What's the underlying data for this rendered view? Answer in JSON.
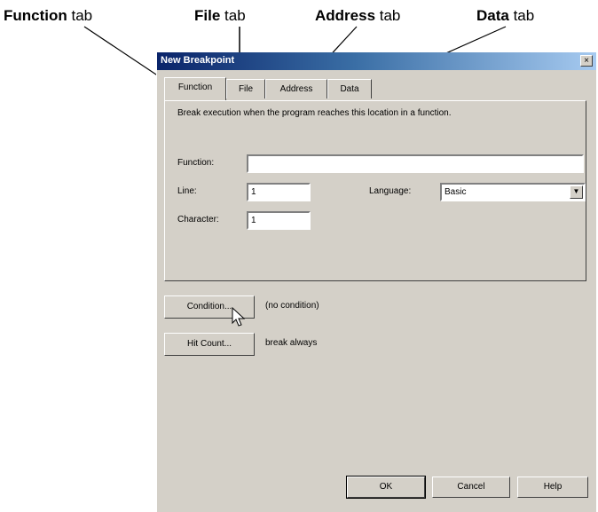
{
  "callouts": {
    "function": {
      "bold": "Function",
      "rest": " tab"
    },
    "file": {
      "bold": "File",
      "rest": " tab"
    },
    "address": {
      "bold": "Address",
      "rest": " tab"
    },
    "data": {
      "bold": "Data",
      "rest": " tab"
    }
  },
  "dialog": {
    "title": "New Breakpoint",
    "close_glyph": "×",
    "tabs": [
      "Function",
      "File",
      "Address",
      "Data"
    ],
    "active_tab": 0,
    "description": "Break execution when the program reaches this location in a function.",
    "function_label": "Function:",
    "function_value": "",
    "line_label": "Line:",
    "line_value": "1",
    "language_label": "Language:",
    "language_value": "Basic",
    "character_label": "Character:",
    "character_value": "1",
    "condition_button": "Condition...",
    "condition_status": "(no condition)",
    "hitcount_button": "Hit Count...",
    "hitcount_status": "break always",
    "ok_button": "OK",
    "cancel_button": "Cancel",
    "help_button": "Help"
  },
  "icons": {
    "combo": "dropdown-arrow-icon",
    "cursor": "mouse-pointer-icon"
  }
}
